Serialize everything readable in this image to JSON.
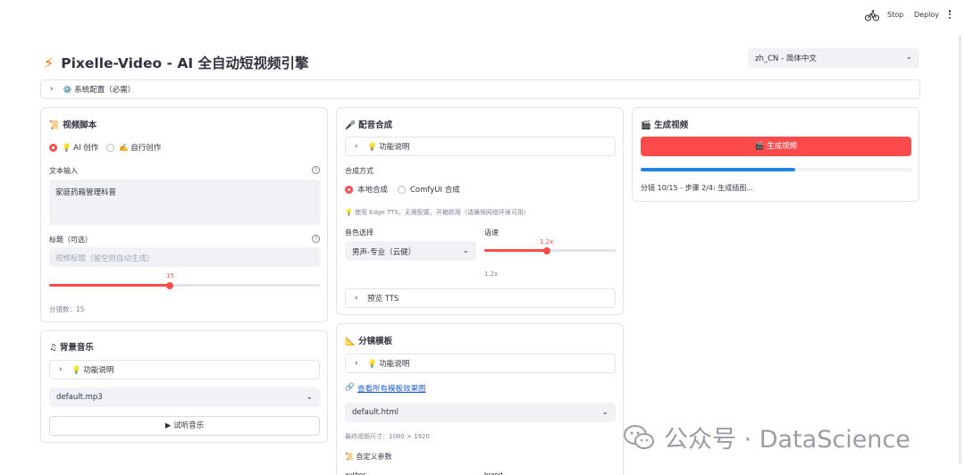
{
  "topbar": {
    "stop": "Stop",
    "deploy": "Deploy"
  },
  "header": {
    "title": "Pixelle-Video - AI 全自动短视频引擎"
  },
  "language": {
    "selected": "zh_CN - 简体中文"
  },
  "system_config": {
    "label": "⚙️ 系统配置（必需）"
  },
  "script_card": {
    "title": "视频脚本",
    "mode_ai": "💡 AI 创作",
    "mode_custom": "✍️ 自行创作",
    "text_input_label": "文本输入",
    "text_input_value": "家庭药箱管理科普",
    "title_label": "标题（可选）",
    "title_placeholder": "视频标题（留空则自动生成）",
    "scene_count": 15,
    "scene_count_label": "15",
    "scene_count_text": "分镜数：15"
  },
  "bgm_card": {
    "title": "背景音乐",
    "help_label": "💡 功能说明",
    "selected": "default.mp3",
    "preview_button": "▶ 试听音乐"
  },
  "voice_card": {
    "title": "配音合成",
    "help_label": "💡 功能说明",
    "method_label": "合成方式",
    "method_local": "本地合成",
    "method_comfy": "ComfyUI 合成",
    "note": "💡 使用 Edge TTS，无需配置，开箱即用（请确保网络环境可用）",
    "voice_label": "音色选择",
    "voice_selected": "男声-专业（云健）",
    "speed_label": "语速",
    "speed_value": "1.2x",
    "speed_fraction": 0.5,
    "speed_caption": "1.2x",
    "preview_tts": "预览 TTS"
  },
  "template_card": {
    "title": "分镜模板",
    "help_label": "💡 功能说明",
    "view_all_link": "查看所有模板效果图",
    "selected": "default.html",
    "size_note": "最终视频尺寸：1080 × 1920",
    "custom_params": "自定义参数",
    "param_a": "author",
    "param_b": "brand"
  },
  "generate_card": {
    "title": "生成视频",
    "button": "🎬 生成视频",
    "progress": 0.57,
    "status": "分镜 10/15 - 步骤 2/4: 生成插图..."
  },
  "watermark": {
    "text": "公众号 · DataScience"
  },
  "colors": {
    "accent": "#ff4b4b",
    "progress": "#1c83e1",
    "input_bg": "#f0f2f6"
  }
}
